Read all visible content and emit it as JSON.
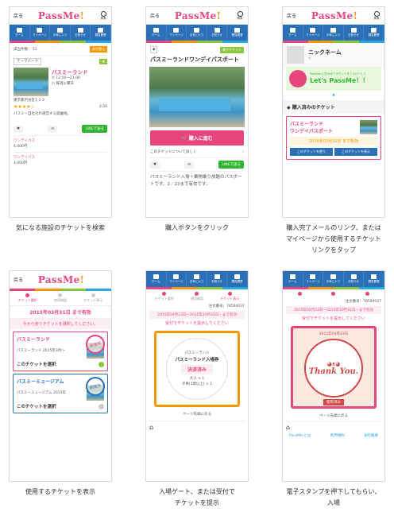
{
  "captions": {
    "c1": "気になる施設のチケットを検索",
    "c2": "購入ボタンをクリック",
    "c3": "購入完了メールのリンク、または",
    "c3b": "マイページから使用するチケット",
    "c3c": "リンクをタップ",
    "c4": "使用するチケットを表示",
    "c5": "入場ゲート、または受付で",
    "c5b": "チケットを提示",
    "c6": "電子スタンプを押下してもらい、",
    "c6b": "入場"
  },
  "common": {
    "back": "戻る",
    "logo_main": "PassMe",
    "logo_bang": "!",
    "search_label": "検索",
    "nav": [
      "ホーム",
      "マイページ",
      "お気に入り",
      "お知らせ",
      "閲覧履歴"
    ]
  },
  "screen1": {
    "count_label": "該当件数： 51",
    "sort_label": "並び替え",
    "facility_name": "パスミーランド",
    "facility_label": "テーマパーク",
    "facility_time": "12:00〜21:00",
    "holiday": "毎週火曜日",
    "address": "東京都渋谷区1-2-3",
    "rating": "4.50",
    "description": "パスミー自社社の運営する遊園地。",
    "ticket1": "ワンデイパス",
    "ticket2": "ワンデイパス",
    "price1": "4,000円",
    "price2": "4,000円",
    "line_btn": "LINEで送る"
  },
  "screen2": {
    "badge": "電子チケット",
    "title": "パスミーランドワンデイパスポート",
    "buy_btn": "購入に進む",
    "link_text": "このチケットについて詳しく",
    "line_btn": "LINEで送る",
    "desc": "パスミーランド入場＋乗物乗り放題のパスポートです。2／22まで有効です。"
  },
  "screen3": {
    "nickname": "ニックネーム",
    "banner_title": "Let's PassMe！！",
    "banner_sub": "PassMe!公式LINEアカウントをフォローして",
    "section": "購入済みのチケット",
    "ticket_name": "パスミーランド",
    "ticket_sub": "ワンデイパスポート",
    "expire": "2015年03月31日 まで有効",
    "btn1": "このチケットを使う",
    "btn2": "このチケットを表示"
  },
  "screen4": {
    "steps": [
      "チケット選択",
      "使用確認",
      "チケット表示"
    ],
    "expire": "2015年03月31日 まで有効",
    "select_note": "今から使うチケットを選択してください。",
    "t1_name": "パスミーランド",
    "t1_desc": "パスミーランド 2015年3月〜",
    "t1_stamp": "未使用",
    "t2_name": "パスミーミュージアム",
    "t2_desc": "パスミーミュージアム 2015年",
    "t2_stamp": "期限外",
    "select_btn": "このチケットを選択"
  },
  "screen5": {
    "steps": [
      "チケット選択",
      "使用確認",
      "チケット表示"
    ],
    "order": "注文番号：78594037",
    "range": "2015年04月23日〜2015年10月31日・まで有効",
    "notice": "受付でチケットを提示してください",
    "ticket_label": "パスミーランド",
    "ticket_title": "パスミーランド入場券",
    "status": "決済済み",
    "adult": "大人 × 1",
    "child": "子供(3歳以上) × 1",
    "page_top": "ページ先頭に戻る"
  },
  "screen6": {
    "order": "注文番号：78594037",
    "range": "2015年04月23日〜2015年10月31日・まで有効",
    "notice": "受付でチケットを提示してください",
    "stamp_date": "2015年04月23日",
    "stamp_text": "Thank You.",
    "used": "使用済み",
    "page_top": "ページ先頭に戻る",
    "footer": [
      "PassMe!とは",
      "利用規約",
      "会社概要"
    ]
  }
}
